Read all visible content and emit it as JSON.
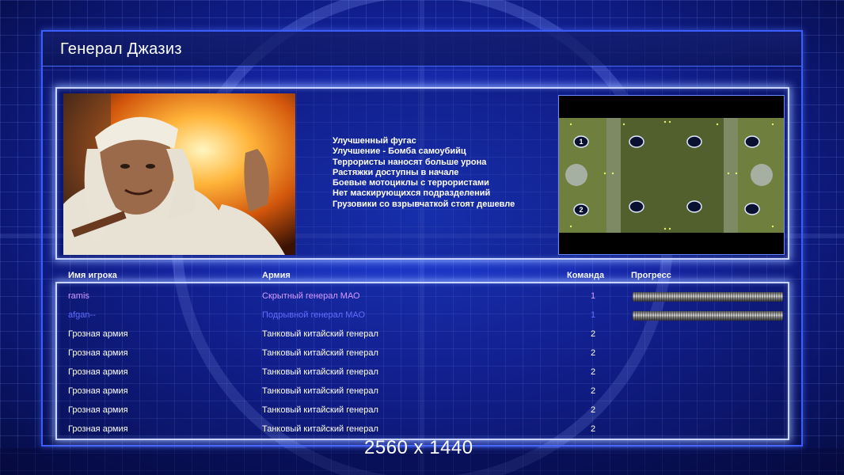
{
  "title": "Генерал Джазиз",
  "bonuses": [
    "Улучшенный фугас",
    "Улучшение - Бомба самоубийц",
    "Террористы наносят больше урона",
    "Растяжки доступны в начале",
    "Боевые мотоциклы с террористами",
    "Нет маскирующихся подразделений",
    "Грузовики со взрывчаткой стоят дешевле"
  ],
  "columns": {
    "player": "Имя игрока",
    "army": "Армия",
    "team": "Команда",
    "progress": "Прогресс"
  },
  "players": [
    {
      "name": "ramis",
      "army": "Скрытный генерал МАО",
      "team": "1",
      "progress": 1.0,
      "color": "#d49bff"
    },
    {
      "name": "afgan--",
      "army": "Подрывной генерал МАО",
      "team": "1",
      "progress": 1.0,
      "color": "#5e6dff"
    },
    {
      "name": "Грозная армия",
      "army": "Танковый китайский генерал",
      "team": "2",
      "color": "#ffffff"
    },
    {
      "name": "Грозная армия",
      "army": "Танковый китайский генерал",
      "team": "2",
      "color": "#ffffff"
    },
    {
      "name": "Грозная армия",
      "army": "Танковый китайский генерал",
      "team": "2",
      "color": "#ffffff"
    },
    {
      "name": "Грозная армия",
      "army": "Танковый китайский генерал",
      "team": "2",
      "color": "#ffffff"
    },
    {
      "name": "Грозная армия",
      "army": "Танковый китайский генерал",
      "team": "2",
      "color": "#ffffff"
    },
    {
      "name": "Грозная армия",
      "army": "Танковый китайский генерал",
      "team": "2",
      "color": "#ffffff"
    }
  ],
  "map": {
    "start_labels": [
      "1",
      "2"
    ]
  },
  "watermark": "2560 x 1440",
  "colors": {
    "background": "#14239e",
    "frame": "#3b5cff",
    "panel_border": "#c8d4ff"
  }
}
